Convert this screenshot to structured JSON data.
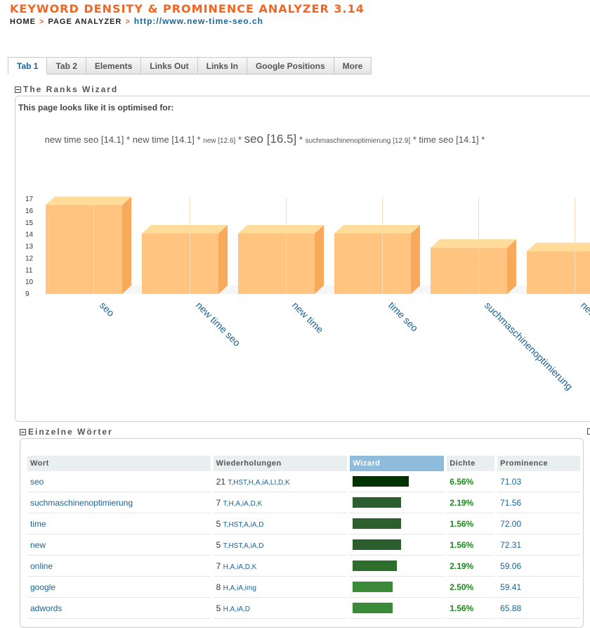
{
  "app": {
    "title": "KEYWORD DENSITY & PROMINENCE ANALYZER 3.14"
  },
  "breadcrumb": {
    "home": "HOME",
    "page": "PAGE ANALYZER",
    "url": "http://www.new-time-seo.ch",
    "separator": ">"
  },
  "tabs": [
    {
      "label": "Tab 1",
      "active": true
    },
    {
      "label": "Tab 2"
    },
    {
      "label": "Elements"
    },
    {
      "label": "Links Out"
    },
    {
      "label": "Links In"
    },
    {
      "label": "Google Positions"
    },
    {
      "label": "More"
    }
  ],
  "ranks_wizard": {
    "title": "The Ranks Wizard",
    "intro": "This page looks like it is optimised for:",
    "summary": [
      {
        "text": "new time seo [14.1]",
        "size": "normal"
      },
      {
        "text": " * ",
        "size": "normal"
      },
      {
        "text": "new time [14.1]",
        "size": "normal"
      },
      {
        "text": " * ",
        "size": "normal"
      },
      {
        "text": "new [12.6]",
        "size": "small"
      },
      {
        "text": " * ",
        "size": "normal"
      },
      {
        "text": "seo [16.5]",
        "size": "big"
      },
      {
        "text": " * ",
        "size": "normal"
      },
      {
        "text": "suchmaschinenoptimierung [12.9]",
        "size": "small"
      },
      {
        "text": " * ",
        "size": "normal"
      },
      {
        "text": "time seo [14.1]",
        "size": "normal"
      },
      {
        "text": " *",
        "size": "normal"
      }
    ]
  },
  "chart_data": {
    "type": "bar",
    "categories": [
      "seo",
      "new time seo",
      "new time",
      "time seo",
      "suchmaschinenoptimierung",
      "new"
    ],
    "values": [
      16.5,
      14.1,
      14.1,
      14.1,
      12.9,
      12.6
    ],
    "ylim": [
      9,
      17
    ],
    "yticks": [
      9,
      10,
      11,
      12,
      13,
      14,
      15,
      16,
      17
    ],
    "xlabel": "",
    "ylabel": "",
    "title": "",
    "grid": true,
    "bar_color": "#ffc580"
  },
  "words": {
    "title": "Einzelne Wörter",
    "headers": [
      "Wort",
      "Wiederholungen",
      "Wizard",
      "Dichte",
      "Prominence"
    ],
    "rows": [
      {
        "word": "seo",
        "count": "21",
        "codes": "T,HST,H,A,iA,LI,D,K",
        "wizard": 0.7,
        "wizard_color": "#003300",
        "density": "6.56%",
        "prominence": "71.03"
      },
      {
        "word": "suchmaschinenoptimierung",
        "count": "7",
        "codes": "T,H,A,iA,D,K",
        "wizard": 0.6,
        "wizard_color": "#2d5e2d",
        "density": "2.19%",
        "prominence": "71.56"
      },
      {
        "word": "time",
        "count": "5",
        "codes": "T,HST,A,iA,D",
        "wizard": 0.6,
        "wizard_color": "#2d5e2d",
        "density": "1.56%",
        "prominence": "72.00"
      },
      {
        "word": "new",
        "count": "5",
        "codes": "T,HST,A,iA,D",
        "wizard": 0.6,
        "wizard_color": "#2d5e2d",
        "density": "1.56%",
        "prominence": "72.31"
      },
      {
        "word": "online",
        "count": "7",
        "codes": "H,A,iA,D,K",
        "wizard": 0.55,
        "wizard_color": "#2d6e2d",
        "density": "2.19%",
        "prominence": "59.06"
      },
      {
        "word": "google",
        "count": "8",
        "codes": "H,A,iA,img",
        "wizard": 0.5,
        "wizard_color": "#3a8a3a",
        "density": "2.50%",
        "prominence": "59.41"
      },
      {
        "word": "adwords",
        "count": "5",
        "codes": "H,A,iA,D",
        "wizard": 0.5,
        "wizard_color": "#3a8a3a",
        "density": "1.56%",
        "prominence": "65.88"
      }
    ]
  }
}
